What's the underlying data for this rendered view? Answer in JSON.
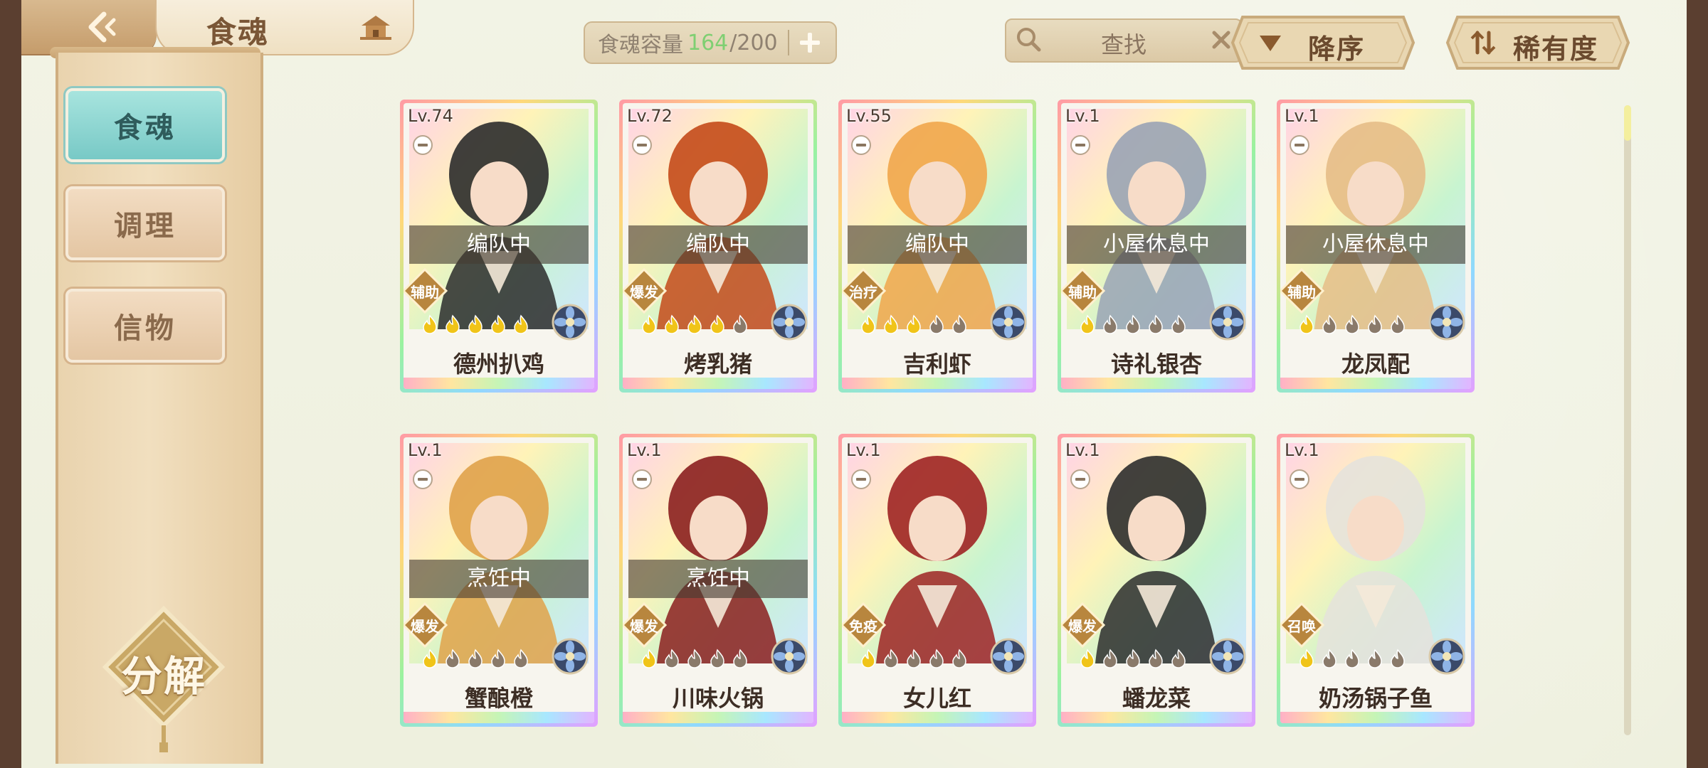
{
  "header": {
    "title": "食魂",
    "capacity_label": "食魂容量",
    "capacity_used": "164",
    "capacity_sep": "/",
    "capacity_total": "200",
    "search_placeholder": "查找",
    "sort_order_label": "降序",
    "sort_by_label": "稀有度"
  },
  "sidebar": {
    "tabs": [
      {
        "label": "食魂",
        "active": true
      },
      {
        "label": "调理",
        "active": false
      },
      {
        "label": "信物",
        "active": false
      }
    ],
    "decompose_label": "分解"
  },
  "cards": [
    {
      "level": "Lv.74",
      "status": "编队中",
      "role": "辅助",
      "stars": 5,
      "name": "德州扒鸡",
      "tone": "#2b2b2b"
    },
    {
      "level": "Lv.72",
      "status": "编队中",
      "role": "爆发",
      "stars": 4,
      "name": "烤乳猪",
      "tone": "#c44a1a"
    },
    {
      "level": "Lv.55",
      "status": "编队中",
      "role": "治疗",
      "stars": 3,
      "name": "吉利虾",
      "tone": "#f1a64b"
    },
    {
      "level": "Lv.1",
      "status": "小屋休息中",
      "role": "辅助",
      "stars": 1,
      "name": "诗礼银杏",
      "tone": "#9aa3b5"
    },
    {
      "level": "Lv.1",
      "status": "小屋休息中",
      "role": "辅助",
      "stars": 1,
      "name": "龙凤配",
      "tone": "#e6bd87"
    },
    {
      "level": "Lv.1",
      "status": "烹饪中",
      "role": "爆发",
      "stars": 1,
      "name": "蟹酿橙",
      "tone": "#e0a24a"
    },
    {
      "level": "Lv.1",
      "status": "烹饪中",
      "role": "爆发",
      "stars": 1,
      "name": "川味火锅",
      "tone": "#8b1f1f"
    },
    {
      "level": "Lv.1",
      "status": "",
      "role": "免疫",
      "stars": 1,
      "name": "女儿红",
      "tone": "#9e2323"
    },
    {
      "level": "Lv.1",
      "status": "",
      "role": "爆发",
      "stars": 1,
      "name": "蟠龙菜",
      "tone": "#2d2d2d"
    },
    {
      "level": "Lv.1",
      "status": "",
      "role": "召唤",
      "stars": 1,
      "name": "奶汤锅子鱼",
      "tone": "#e5e2dc"
    }
  ],
  "colors": {
    "capacity_used": "#7fcf72",
    "active_tab": "#78c9c6",
    "star_filled": "#f0c419",
    "star_empty": "#8a7a6a"
  }
}
